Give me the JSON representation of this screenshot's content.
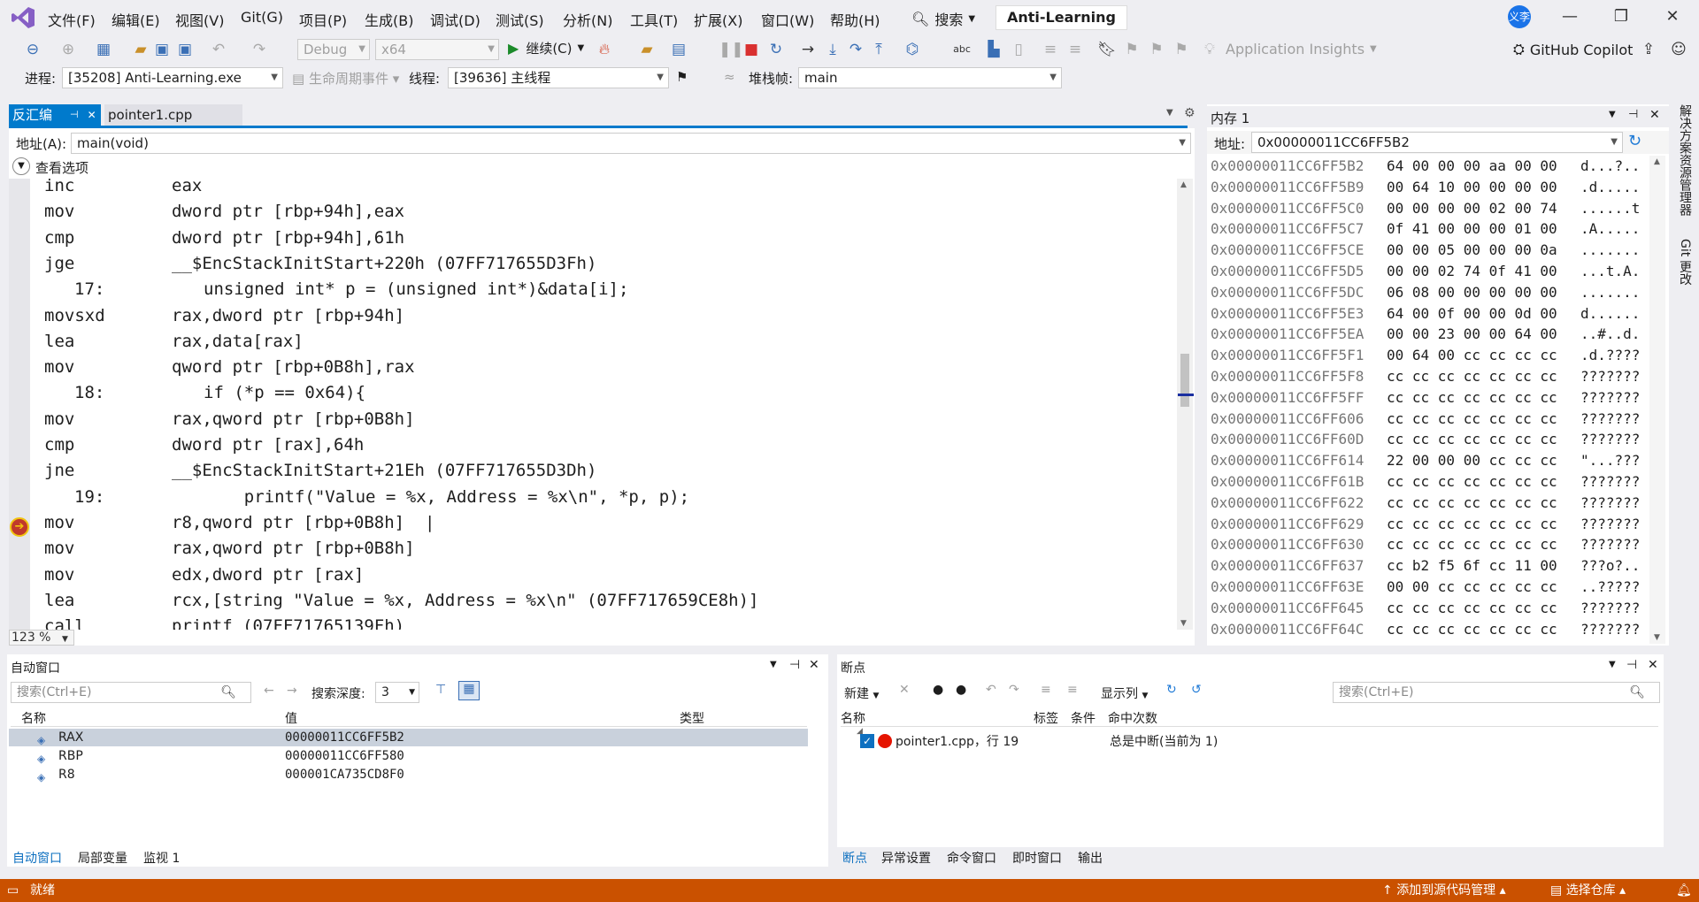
{
  "menu": [
    "文件(F)",
    "编辑(E)",
    "视图(V)",
    "Git(G)",
    "项目(P)",
    "生成(B)",
    "调试(D)",
    "测试(S)",
    "分析(N)",
    "工具(T)",
    "扩展(X)",
    "窗口(W)",
    "帮助(H)"
  ],
  "search_label": "搜索",
  "solution_name": "Anti-Learning",
  "avatar_text": "义李",
  "toolbar": {
    "config": "Debug",
    "platform": "x64",
    "continue": "继续(C)",
    "app_insights": "Application Insights",
    "copilot": "GitHub Copilot"
  },
  "procbar": {
    "process_label": "进程:",
    "process_value": "[35208] Anti-Learning.exe",
    "lifecycle_label": "生命周期事件",
    "thread_label": "线程:",
    "thread_value": "[39636] 主线程",
    "stackframe_label": "堆栈帧:",
    "stackframe_value": "main"
  },
  "tabs": {
    "disasm": "反汇编",
    "source": "pointer1.cpp"
  },
  "disasm": {
    "addr_label": "地址(A):",
    "addr_value": "main(void)",
    "view_options": "查看选项",
    "zoom": "123 %",
    "lines": [
      {
        "kind": "asm",
        "op": "inc",
        "arg": "eax"
      },
      {
        "kind": "asm",
        "op": "mov",
        "arg": "dword ptr [rbp+94h],eax"
      },
      {
        "kind": "asm",
        "op": "cmp",
        "arg": "dword ptr [rbp+94h],61h"
      },
      {
        "kind": "asm",
        "op": "jge",
        "arg": "__$EncStackInitStart+220h (07FF717655D3Fh)"
      },
      {
        "kind": "src",
        "ln": "17:",
        "text": "unsigned int* p = (unsigned int*)&data[i];"
      },
      {
        "kind": "asm",
        "op": "movsxd",
        "arg": "rax,dword ptr [rbp+94h]"
      },
      {
        "kind": "asm",
        "op": "lea",
        "arg": "rax,data[rax]"
      },
      {
        "kind": "asm",
        "op": "mov",
        "arg": "qword ptr [rbp+0B8h],rax"
      },
      {
        "kind": "src",
        "ln": "18:",
        "text": "if (*p == 0x64){"
      },
      {
        "kind": "asm",
        "op": "mov",
        "arg": "rax,qword ptr [rbp+0B8h]"
      },
      {
        "kind": "asm",
        "op": "cmp",
        "arg": "dword ptr [rax],64h"
      },
      {
        "kind": "asm",
        "op": "jne",
        "arg": "__$EncStackInitStart+21Eh (07FF717655D3Dh)"
      },
      {
        "kind": "src",
        "ln": "19:",
        "text": "    printf(\"Value = %x, Address = %x\\n\", *p, p);"
      },
      {
        "kind": "asm",
        "op": "mov",
        "arg": "r8,qword ptr [rbp+0B8h]  |"
      },
      {
        "kind": "asm",
        "op": "mov",
        "arg": "rax,qword ptr [rbp+0B8h]"
      },
      {
        "kind": "asm",
        "op": "mov",
        "arg": "edx,dword ptr [rax]"
      },
      {
        "kind": "asm",
        "op": "lea",
        "arg": "rcx,[string \"Value = %x, Address = %x\\n\" (07FF717659CE8h)]"
      },
      {
        "kind": "asm",
        "op": "call",
        "arg": "printf (07FF71765139Fh)"
      }
    ]
  },
  "memory": {
    "title": "内存 1",
    "addr_label": "地址:",
    "addr_value": "0x00000011CC6FF5B2",
    "rows": [
      {
        "a": "0x00000011CC6FF5B2",
        "b": "64 00 00 00 aa 00 00",
        "c": "d...?.."
      },
      {
        "a": "0x00000011CC6FF5B9",
        "b": "00 64 10 00 00 00 00",
        "c": ".d....."
      },
      {
        "a": "0x00000011CC6FF5C0",
        "b": "00 00 00 00 02 00 74",
        "c": "......t"
      },
      {
        "a": "0x00000011CC6FF5C7",
        "b": "0f 41 00 00 00 01 00",
        "c": ".A....."
      },
      {
        "a": "0x00000011CC6FF5CE",
        "b": "00 00 05 00 00 00 0a",
        "c": "......."
      },
      {
        "a": "0x00000011CC6FF5D5",
        "b": "00 00 02 74 0f 41 00",
        "c": "...t.A."
      },
      {
        "a": "0x00000011CC6FF5DC",
        "b": "06 08 00 00 00 00 00",
        "c": "......."
      },
      {
        "a": "0x00000011CC6FF5E3",
        "b": "64 00 0f 00 00 0d 00",
        "c": "d......"
      },
      {
        "a": "0x00000011CC6FF5EA",
        "b": "00 00 23 00 00 64 00",
        "c": "..#..d."
      },
      {
        "a": "0x00000011CC6FF5F1",
        "b": "00 64 00 cc cc cc cc",
        "c": ".d.????"
      },
      {
        "a": "0x00000011CC6FF5F8",
        "b": "cc cc cc cc cc cc cc",
        "c": "???????"
      },
      {
        "a": "0x00000011CC6FF5FF",
        "b": "cc cc cc cc cc cc cc",
        "c": "???????"
      },
      {
        "a": "0x00000011CC6FF606",
        "b": "cc cc cc cc cc cc cc",
        "c": "???????"
      },
      {
        "a": "0x00000011CC6FF60D",
        "b": "cc cc cc cc cc cc cc",
        "c": "???????"
      },
      {
        "a": "0x00000011CC6FF614",
        "b": "22 00 00 00 cc cc cc",
        "c": "\"...???"
      },
      {
        "a": "0x00000011CC6FF61B",
        "b": "cc cc cc cc cc cc cc",
        "c": "???????"
      },
      {
        "a": "0x00000011CC6FF622",
        "b": "cc cc cc cc cc cc cc",
        "c": "???????"
      },
      {
        "a": "0x00000011CC6FF629",
        "b": "cc cc cc cc cc cc cc",
        "c": "???????"
      },
      {
        "a": "0x00000011CC6FF630",
        "b": "cc cc cc cc cc cc cc",
        "c": "???????"
      },
      {
        "a": "0x00000011CC6FF637",
        "b": "cc b2 f5 6f cc 11 00",
        "c": "???o?.."
      },
      {
        "a": "0x00000011CC6FF63E",
        "b": "00 00 cc cc cc cc cc",
        "c": "..?????"
      },
      {
        "a": "0x00000011CC6FF645",
        "b": "cc cc cc cc cc cc cc",
        "c": "???????"
      },
      {
        "a": "0x00000011CC6FF64C",
        "b": "cc cc cc cc cc cc cc",
        "c": "???????"
      }
    ]
  },
  "side_tabs": [
    "解决方案资源管理器",
    "Git 更改"
  ],
  "autos": {
    "title": "自动窗口",
    "search_placeholder": "搜索(Ctrl+E)",
    "depth_label": "搜索深度:",
    "depth_value": "3",
    "columns": [
      "名称",
      "值",
      "类型"
    ],
    "rows": [
      {
        "name": "RAX",
        "value": "00000011CC6FF5B2"
      },
      {
        "name": "RBP",
        "value": "00000011CC6FF580"
      },
      {
        "name": "R8",
        "value": "000001CA735CD8F0"
      }
    ],
    "tabs": [
      "自动窗口",
      "局部变量",
      "监视 1"
    ]
  },
  "breakpoints": {
    "title": "断点",
    "new_label": "新建",
    "show_cols": "显示列",
    "search_placeholder": "搜索(Ctrl+E)",
    "columns": [
      "名称",
      "标签",
      "条件",
      "命中次数"
    ],
    "rows": [
      {
        "name": "pointer1.cpp，行 19",
        "hits": "总是中断(当前为 1)"
      }
    ],
    "tabs": [
      "断点",
      "异常设置",
      "命令窗口",
      "即时窗口",
      "输出"
    ]
  },
  "status": {
    "ready": "就绪",
    "add_source": "添加到源代码管理",
    "select_repo": "选择仓库"
  }
}
